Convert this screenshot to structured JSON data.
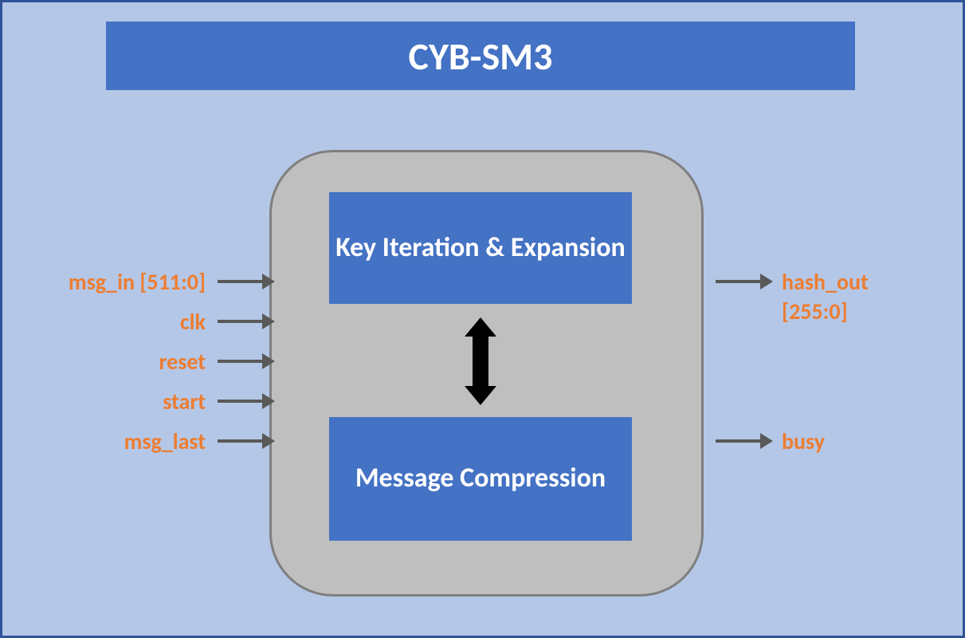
{
  "title": "CYB-SM3",
  "blocks": {
    "top": "Key Iteration & Expansion",
    "bottom": "Message Compression"
  },
  "inputs": {
    "msg_in": "msg_in [511:0]",
    "clk": "clk",
    "reset": "reset",
    "start": "start",
    "msg_last": "msg_last"
  },
  "outputs": {
    "hash_out_line1": "hash_out",
    "hash_out_line2": "[255:0]",
    "busy": "busy"
  },
  "colors": {
    "outer_bg": "#b4c7e7",
    "outer_border": "#2f5597",
    "banner_bg": "#4472c4",
    "core_bg": "#bfbfbf",
    "core_border": "#7f7f7f",
    "block_bg": "#4472c4",
    "label_color": "#ed7d31",
    "arrow_color": "#595959"
  }
}
